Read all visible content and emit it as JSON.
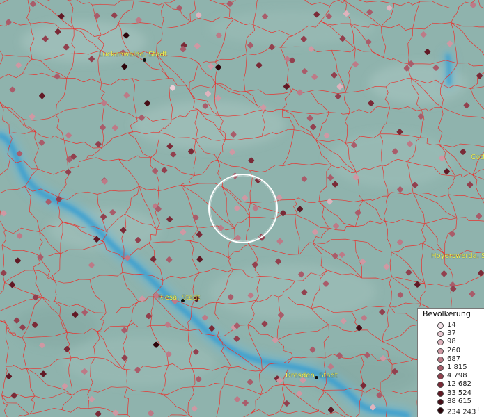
{
  "map": {
    "cities": [
      {
        "id": "luckenwalde",
        "label": "Luckenwalde, Stadt"
      },
      {
        "id": "riesa",
        "label": "Riesa, Stadt"
      },
      {
        "id": "dresden",
        "label": "Dresden, Stadt"
      },
      {
        "id": "hoyerswerda",
        "label": "Hoyerswerda, S"
      },
      {
        "id": "cottbus",
        "label": "Cott"
      }
    ],
    "colors": {
      "background": "#8fb3ad",
      "boundary": "#e8322e",
      "river": "#3c9fcf",
      "selection_circle": "#ffffff",
      "city_label": "#f2f25a"
    },
    "selection_circle_visible": true
  },
  "legend": {
    "title": "Bevölkerung",
    "plus": "+",
    "items": [
      {
        "label": "14",
        "color": "#f6e3ea"
      },
      {
        "label": "37",
        "color": "#eecdd6"
      },
      {
        "label": "98",
        "color": "#dfb3bd"
      },
      {
        "label": "260",
        "color": "#cf98a3"
      },
      {
        "label": "687",
        "color": "#bd7a87"
      },
      {
        "label": "1 815",
        "color": "#a95c6a"
      },
      {
        "label": "4 798",
        "color": "#92404e"
      },
      {
        "label": "12 682",
        "color": "#7a2a37"
      },
      {
        "label": "33 524",
        "color": "#611925"
      },
      {
        "label": "88 615",
        "color": "#470d16"
      },
      {
        "label": "234 243",
        "color": "#2d050b"
      }
    ]
  }
}
